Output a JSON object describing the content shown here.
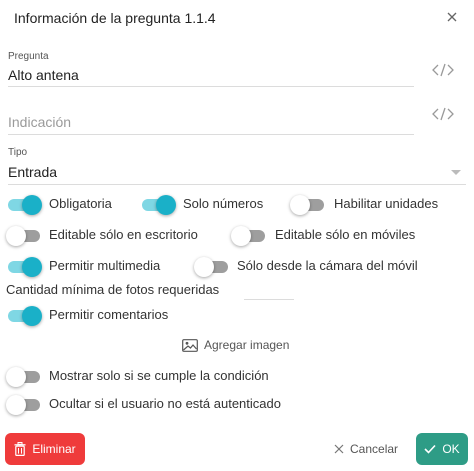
{
  "dialog": {
    "title": "Información de la pregunta 1.1.4",
    "close_icon": "close-icon"
  },
  "fields": {
    "pregunta": {
      "label": "Pregunta",
      "value": "Alto antena",
      "icon": "code-icon"
    },
    "indicacion": {
      "placeholder": "Indicación",
      "icon": "code-icon"
    },
    "tipo": {
      "label": "Tipo",
      "value": "Entrada",
      "icon": "chevron-down-icon"
    }
  },
  "toggles": {
    "obligatoria": {
      "label": "Obligatoria",
      "on": true
    },
    "solo_numeros": {
      "label": "Solo números",
      "on": true
    },
    "habilitar_unidades": {
      "label": "Habilitar unidades",
      "on": false
    },
    "editable_escritorio": {
      "label": "Editable sólo en escritorio",
      "on": false
    },
    "editable_moviles": {
      "label": "Editable sólo en móviles",
      "on": false
    },
    "permitir_multimedia": {
      "label": "Permitir multimedia",
      "on": true
    },
    "solo_camara": {
      "label": "Sólo desde la cámara del móvil",
      "on": false
    },
    "permitir_comentarios": {
      "label": "Permitir comentarios",
      "on": true
    },
    "mostrar_condicion": {
      "label": "Mostrar solo si se cumple la condición",
      "on": false
    },
    "ocultar_no_autenticado": {
      "label": "Ocultar si el usuario no está autenticado",
      "on": false
    }
  },
  "fotos": {
    "label": "Cantidad mínima de fotos requeridas",
    "value": ""
  },
  "add_image": {
    "label": "Agregar imagen",
    "icon": "image-icon"
  },
  "footer": {
    "delete_label": "Eliminar",
    "cancel_label": "Cancelar",
    "ok_label": "OK"
  },
  "colors": {
    "accent": "#1ab0c8",
    "accent_track": "#7fd7e4",
    "delete": "#ef3b3b",
    "ok": "#2e9c86"
  }
}
